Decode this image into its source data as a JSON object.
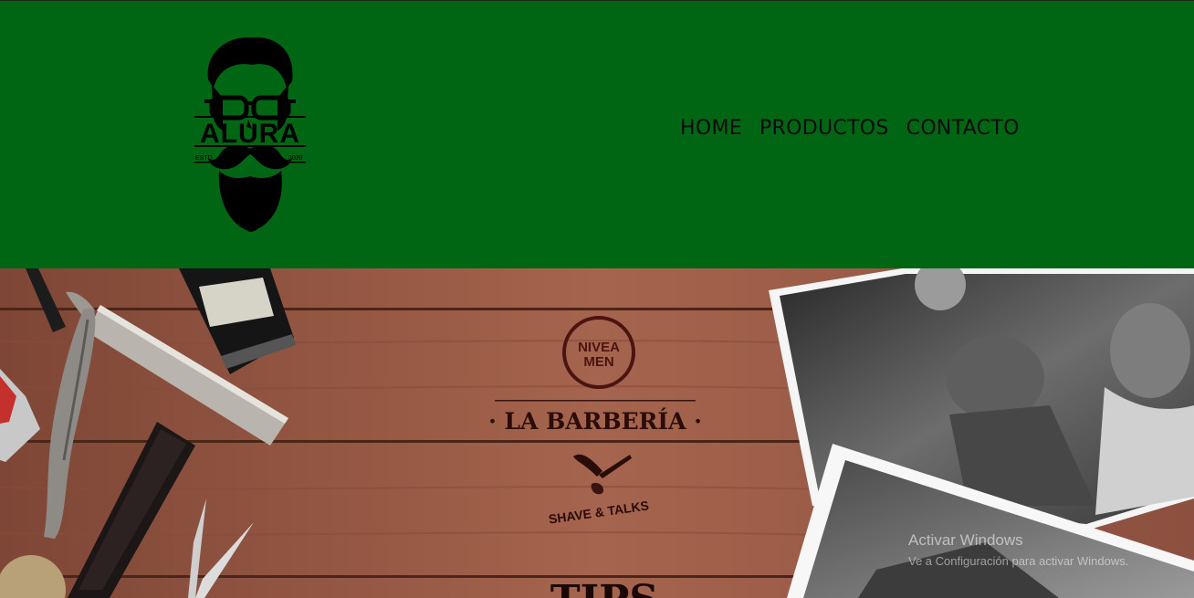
{
  "header": {
    "brand": "ALURA",
    "estd_left": "ESTD",
    "estd_right": "2020",
    "nav": [
      {
        "label": "HOME"
      },
      {
        "label": "PRODUCTOS"
      },
      {
        "label": "CONTACTO"
      }
    ]
  },
  "hero": {
    "sponsor_line1": "NIVEA",
    "sponsor_line2": "MEN",
    "title": "· LA BARBERÍA ·",
    "tagline": "SHAVE & TALKS",
    "bottom_text": "TIPS"
  },
  "watermark": {
    "title": "Activar Windows",
    "subtitle": "Ve a Configuración para activar Windows."
  },
  "colors": {
    "header_bg": "#016613",
    "nav_text": "#0a0a0a",
    "wood": "#9a5a44"
  }
}
